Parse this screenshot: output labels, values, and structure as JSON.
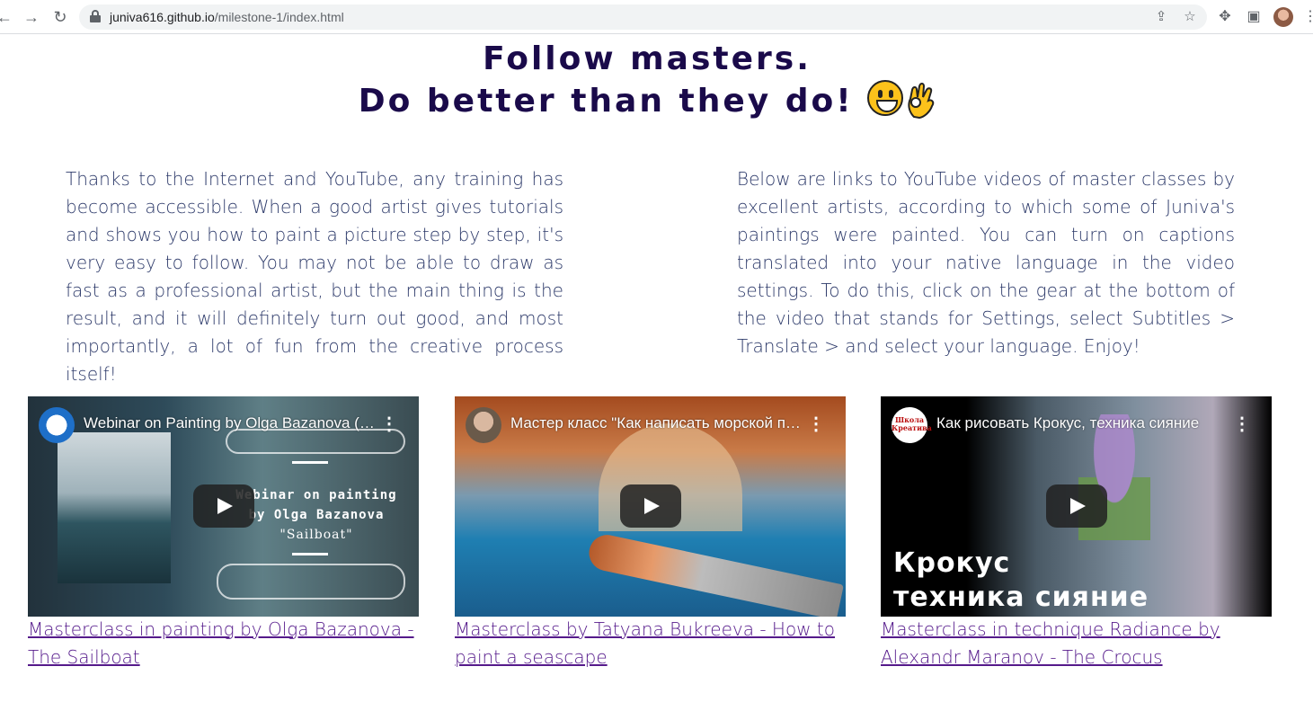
{
  "browser": {
    "url_domain": "juniva616.github.io",
    "url_path": "/milestone-1/index.html",
    "back_icon": "arrow-left",
    "forward_icon": "arrow-right",
    "reload_icon": "reload",
    "share_icon": "share",
    "bookmark_icon": "star",
    "extensions_icon": "puzzle",
    "sidepanel_icon": "sidebar",
    "menu_icon": "three-dots"
  },
  "heading": {
    "line1": "Follow masters.",
    "line2": "Do better than they do!"
  },
  "paragraphs": {
    "left": "Thanks to the Internet and YouTube, any training has become accessible. When a good artist gives tutorials and shows you how to paint a picture step by step, it's very easy to follow. You may not be able to draw as fast as a professional artist, but the main thing is the result, and it will definitely turn out good, and most importantly, a lot of fun from the creative process itself!",
    "right": "Below are links to YouTube videos of master classes by excellent artists, according to which some of Juniva's paintings were painted. You can turn on captions translated into your native language in the video settings. To do this, click on the gear at the bottom of the video that stands for Settings, select Subtitles > Translate > and select your language. Enjoy!"
  },
  "videos": [
    {
      "title": "Webinar on Painting by Olga Bazanova (Sailboat)",
      "overlay_line1": "Webinar on painting",
      "overlay_line2": "by Olga Bazanova",
      "overlay_line3": "\"Sailboat\"",
      "link": "Masterclass in painting by Olga Bazanova - The Sailboat"
    },
    {
      "title": "Мастер класс \"Как написать морской пейзаж\"",
      "link": "Masterclass by Tatyana Bukreeva - How to paint a seascape"
    },
    {
      "title": "Как рисовать Крокус, техника сияние",
      "channel_badge": "Школа Креатива",
      "overlay_line1": "Крокус",
      "overlay_line2": "техника сияние",
      "link": "Masterclass in technique Radiance by Alexandr Maranov - The Crocus"
    }
  ],
  "colors": {
    "heading": "#1a0a4a",
    "paragraph": "#2d3a6a",
    "link_visited": "#551a8b"
  }
}
